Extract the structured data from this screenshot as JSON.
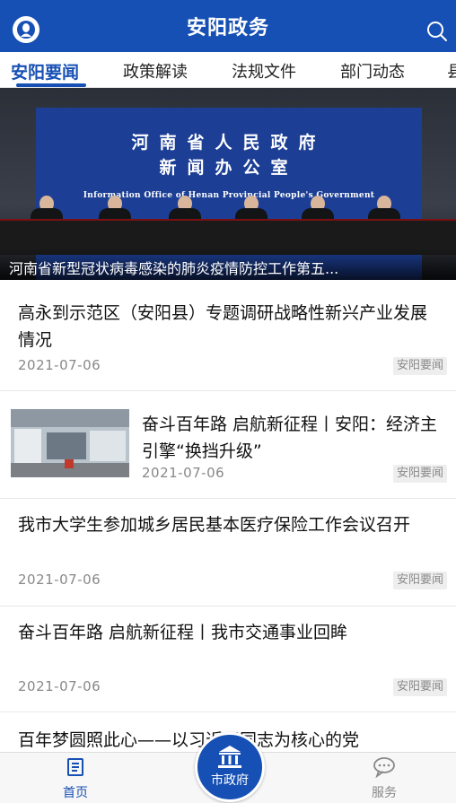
{
  "header": {
    "title": "安阳政务",
    "brand_color": "#1750b4"
  },
  "tabs": [
    {
      "label": "安阳要闻",
      "active": true
    },
    {
      "label": "政策解读"
    },
    {
      "label": "法规文件"
    },
    {
      "label": "部门动态"
    },
    {
      "label": "县"
    }
  ],
  "hero": {
    "board_line1": "河南省人民政府",
    "board_line2": "新闻办公室",
    "board_line3": "Information Office of Henan Provincial People's Government",
    "caption": "河南省新型冠状病毒感染的肺炎疫情防控工作第五..."
  },
  "news": [
    {
      "title": "高永到示范区（安阳县）专题调研战略性新兴产业发展情况",
      "date": "2021-07-06",
      "tag": "安阳要闻"
    },
    {
      "title": "奋斗百年路 启航新征程丨安阳：经济主引擎“换挡升级”",
      "date": "2021-07-06",
      "tag": "安阳要闻",
      "has_thumb": true
    },
    {
      "title": "我市大学生参加城乡居民基本医疗保险工作会议召开",
      "date": "2021-07-06",
      "tag": "安阳要闻"
    },
    {
      "title": "奋斗百年路 启航新征程丨我市交通事业回眸",
      "date": "2021-07-06",
      "tag": "安阳要闻"
    },
    {
      "title": "百年梦圆照此心——以习近平同志为核心的党",
      "date": "",
      "tag": ""
    }
  ],
  "bottom_nav": {
    "home": "首页",
    "center": "市政府",
    "service": "服务"
  }
}
